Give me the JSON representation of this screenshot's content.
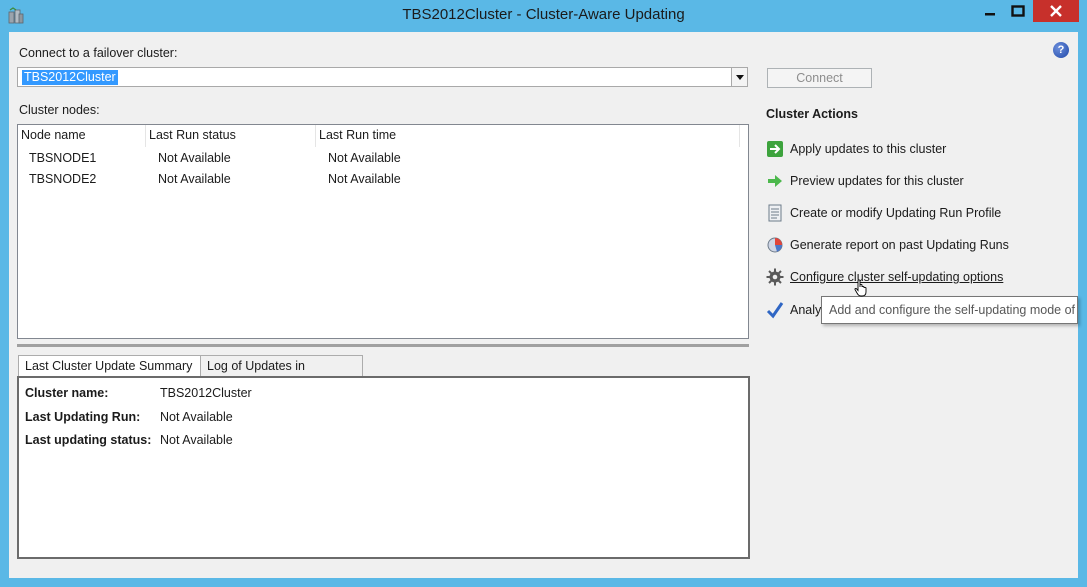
{
  "window": {
    "title": "TBS2012Cluster - Cluster-Aware Updating",
    "icon": "cluster-updating-app-icon",
    "accent_color": "#5ab8e6",
    "close_button_color": "#c7302b"
  },
  "connect": {
    "label": "Connect to a failover cluster:",
    "selected_cluster": "TBS2012Cluster",
    "connect_button": "Connect"
  },
  "nodes": {
    "label": "Cluster nodes:",
    "columns": [
      "Node name",
      "Last Run status",
      "Last Run time"
    ],
    "rows": [
      [
        "TBSNODE1",
        "Not Available",
        "Not Available"
      ],
      [
        "TBSNODE2",
        "Not Available",
        "Not Available"
      ]
    ]
  },
  "tabs": [
    "Last Cluster Update Summary",
    "Log of Updates in Progress"
  ],
  "summary": {
    "cluster_name_label": "Cluster name:",
    "cluster_name_value": "TBS2012Cluster",
    "last_run_label": "Last Updating Run:",
    "last_run_value": "Not Available",
    "last_status_label": "Last updating status:",
    "last_status_value": "Not Available"
  },
  "actions": {
    "title": "Cluster Actions",
    "items": [
      {
        "label": "Apply updates to this cluster",
        "icon": "apply-updates-icon"
      },
      {
        "label": "Preview updates for this cluster",
        "icon": "preview-arrow-icon"
      },
      {
        "label": "Create or modify Updating Run Profile",
        "icon": "profile-document-icon"
      },
      {
        "label": "Generate report on past Updating Runs",
        "icon": "report-chart-icon"
      },
      {
        "label": "Configure cluster self-updating options",
        "icon": "gear-icon"
      },
      {
        "label": "Analy",
        "icon": "checkmark-icon"
      }
    ]
  },
  "tooltip": "Add and configure the self-updating mode of"
}
